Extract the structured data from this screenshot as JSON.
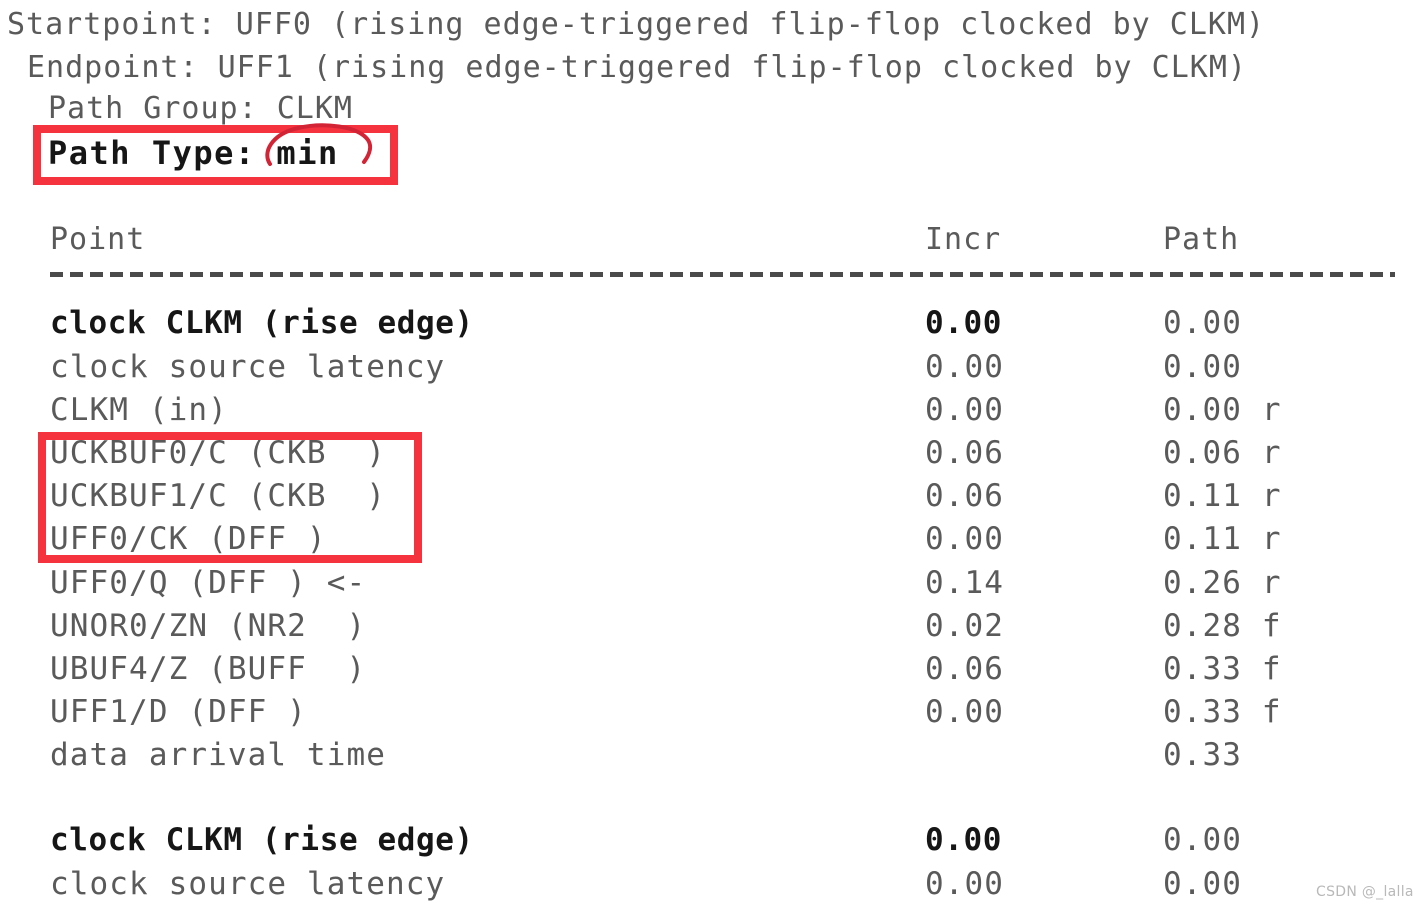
{
  "document": {
    "type": "static-timing-analysis-report",
    "header_lines": [
      {
        "indent": 0,
        "text": "Startpoint: UFF0 (rising edge-triggered flip-flop clocked by CLKM)"
      },
      {
        "indent": 1,
        "text": "Endpoint: UFF1 (rising edge-triggered flip-flop clocked by CLKM)"
      },
      {
        "indent": 2,
        "text": "Path Group: CLKM"
      },
      {
        "indent": 2,
        "text": "Path Type: min",
        "bold": true,
        "highlighted": true
      }
    ],
    "columns": {
      "point": "Point",
      "incr": "Incr",
      "path": "Path"
    },
    "separator": "-----------------------------------------------------------------",
    "rows": [
      {
        "point": "clock CLKM (rise edge)",
        "incr": "0.00",
        "path": "0.00",
        "bold": true
      },
      {
        "point": "clock source latency",
        "incr": "0.00",
        "path": "0.00",
        "bold": false
      },
      {
        "point": "CLKM (in)",
        "incr": "0.00",
        "path": "0.00 r",
        "bold": false
      },
      {
        "point": "UCKBUF0/C (CKB  )",
        "incr": "0.06",
        "path": "0.06 r",
        "bold": false,
        "highlighted": true
      },
      {
        "point": "UCKBUF1/C (CKB  )",
        "incr": "0.06",
        "path": "0.11 r",
        "bold": false,
        "highlighted": true
      },
      {
        "point": "UFF0/CK (DFF )",
        "incr": "0.00",
        "path": "0.11 r",
        "bold": false,
        "highlighted": true
      },
      {
        "point": "UFF0/Q (DFF ) <-",
        "incr": "0.14",
        "path": "0.26 r",
        "bold": false
      },
      {
        "point": "UNOR0/ZN (NR2  )",
        "incr": "0.02",
        "path": "0.28 f",
        "bold": false
      },
      {
        "point": "UBUF4/Z (BUFF  )",
        "incr": "0.06",
        "path": "0.33 f",
        "bold": false
      },
      {
        "point": "UFF1/D (DFF )",
        "incr": "0.00",
        "path": "0.33 f",
        "bold": false
      },
      {
        "point": "data arrival time",
        "incr": "",
        "path": "0.33",
        "bold": false
      },
      {
        "point": "",
        "incr": "",
        "path": "",
        "bold": false,
        "spacer": true
      },
      {
        "point": "clock CLKM (rise edge)",
        "incr": "0.00",
        "path": "0.00",
        "bold": true
      },
      {
        "point": "clock source latency",
        "incr": "0.00",
        "path": "0.00",
        "bold": false
      }
    ]
  },
  "annotations": {
    "box_color": "#f5333f",
    "curve_color": "#d32436",
    "highlight_path_type": "Path Type: min",
    "highlight_clock_path_cells": [
      "UCKBUF0/C (CKB  )",
      "UCKBUF1/C (CKB  )",
      "UFF0/CK (DFF )"
    ]
  },
  "watermark": {
    "text": "CSDN @_lalla"
  }
}
